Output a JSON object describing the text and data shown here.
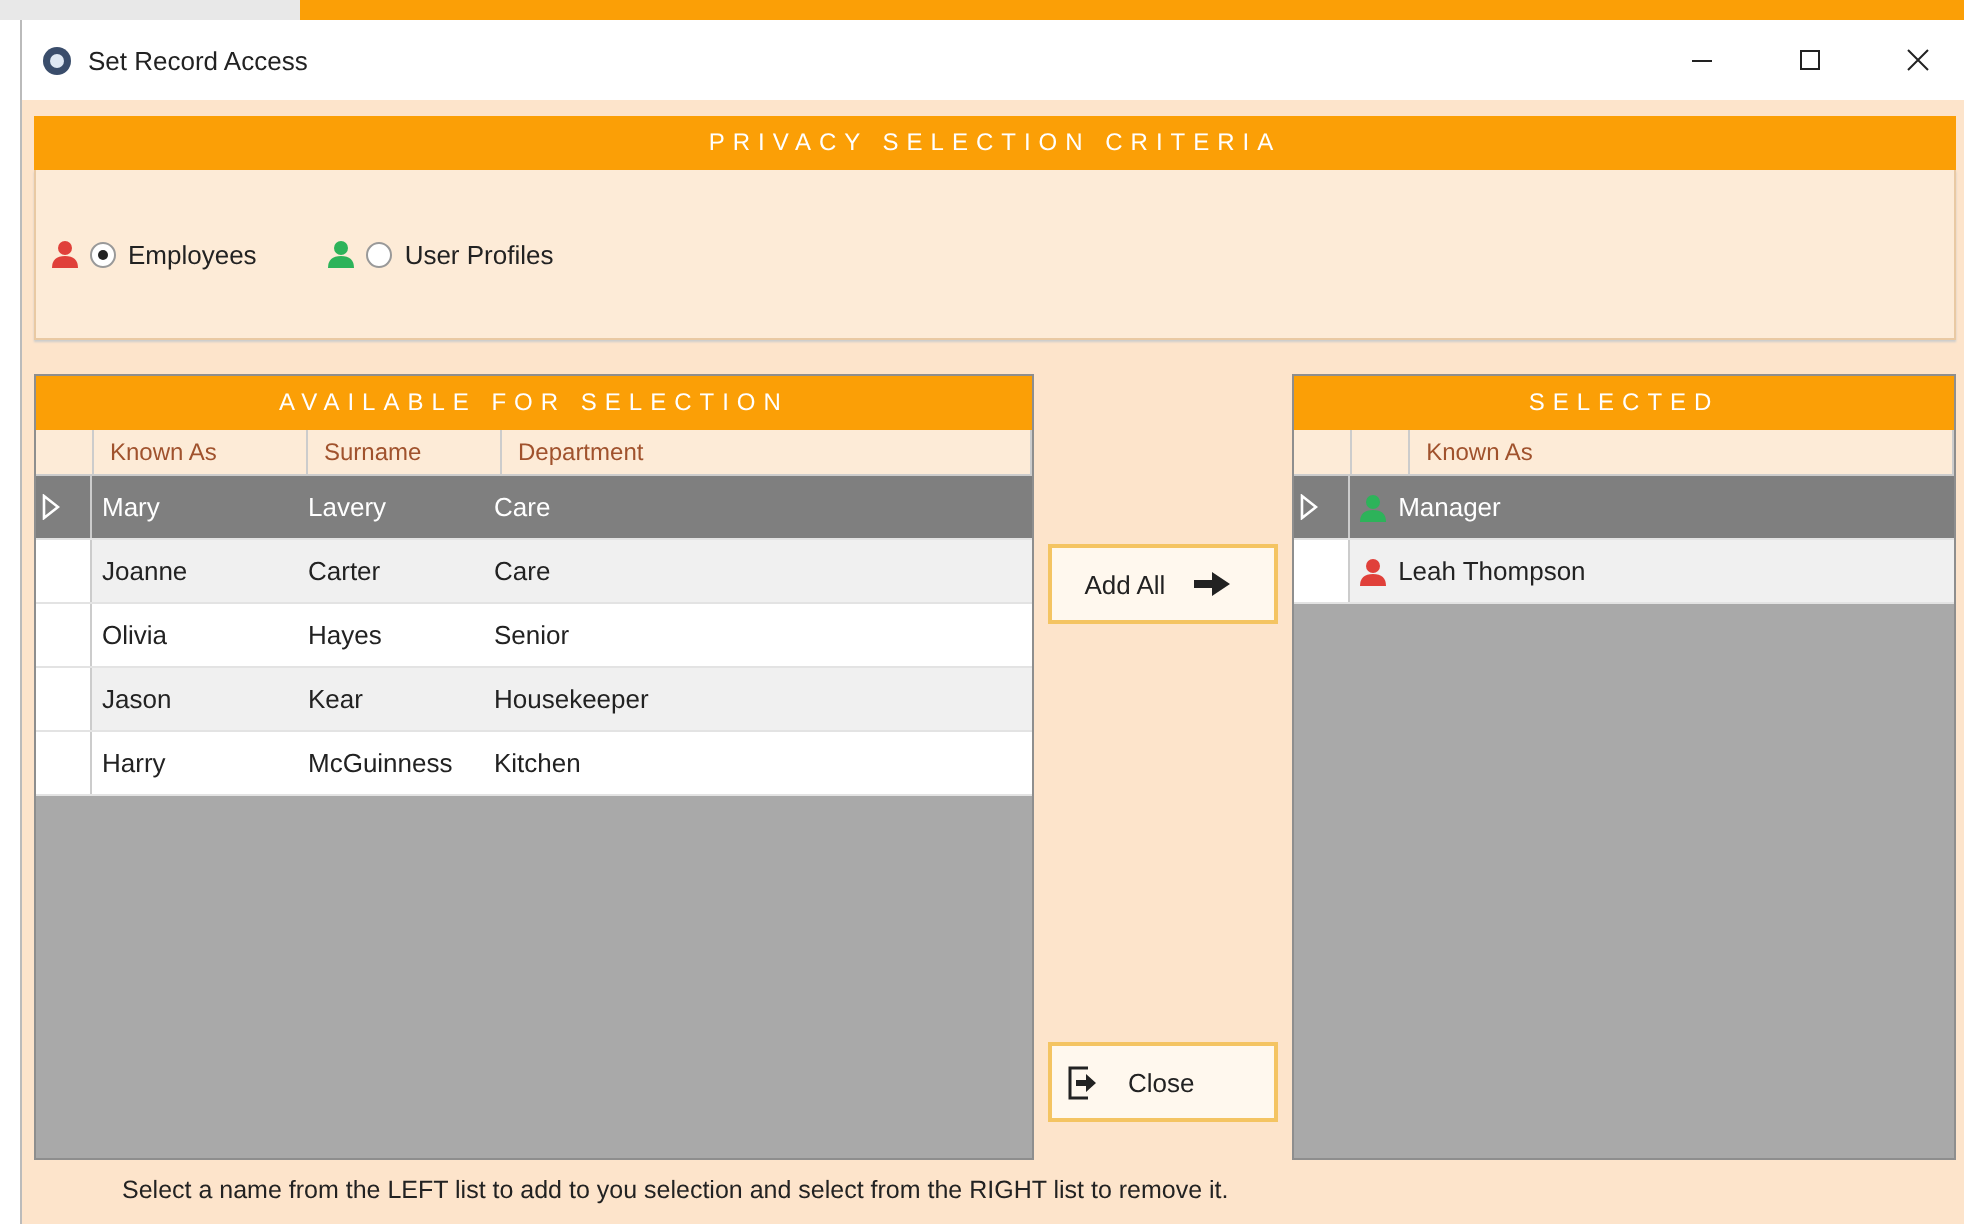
{
  "window": {
    "title": "Set Record Access"
  },
  "criteria": {
    "title": "PRIVACY SELECTION CRITERIA",
    "options": [
      {
        "label": "Employees",
        "kind": "employee",
        "selected": true
      },
      {
        "label": "User Profiles",
        "kind": "user_profile",
        "selected": false
      }
    ]
  },
  "available": {
    "title": "AVAILABLE FOR SELECTION",
    "columns": [
      "Known As",
      "Surname",
      "Department"
    ],
    "rows": [
      {
        "cells": [
          "Mary",
          "Lavery",
          "Care"
        ],
        "selected": true
      },
      {
        "cells": [
          "Joanne",
          "Carter",
          "Care"
        ],
        "selected": false
      },
      {
        "cells": [
          "Olivia",
          "Hayes",
          "Senior"
        ],
        "selected": false
      },
      {
        "cells": [
          "Jason",
          "Kear",
          "Housekeeper"
        ],
        "selected": false
      },
      {
        "cells": [
          "Harry",
          "McGuinness",
          "Kitchen"
        ],
        "selected": false
      }
    ]
  },
  "buttons": {
    "add_all": "Add All",
    "close": "Close"
  },
  "selected_list": {
    "title": "SELECTED",
    "columns": [
      "Known As"
    ],
    "rows": [
      {
        "name": "Manager",
        "kind": "user_profile",
        "selected": true
      },
      {
        "name": "Leah Thompson",
        "kind": "employee",
        "selected": false
      }
    ]
  },
  "status_bar": "Select a name from the LEFT list to add to you selection and select from the RIGHT list to remove it."
}
